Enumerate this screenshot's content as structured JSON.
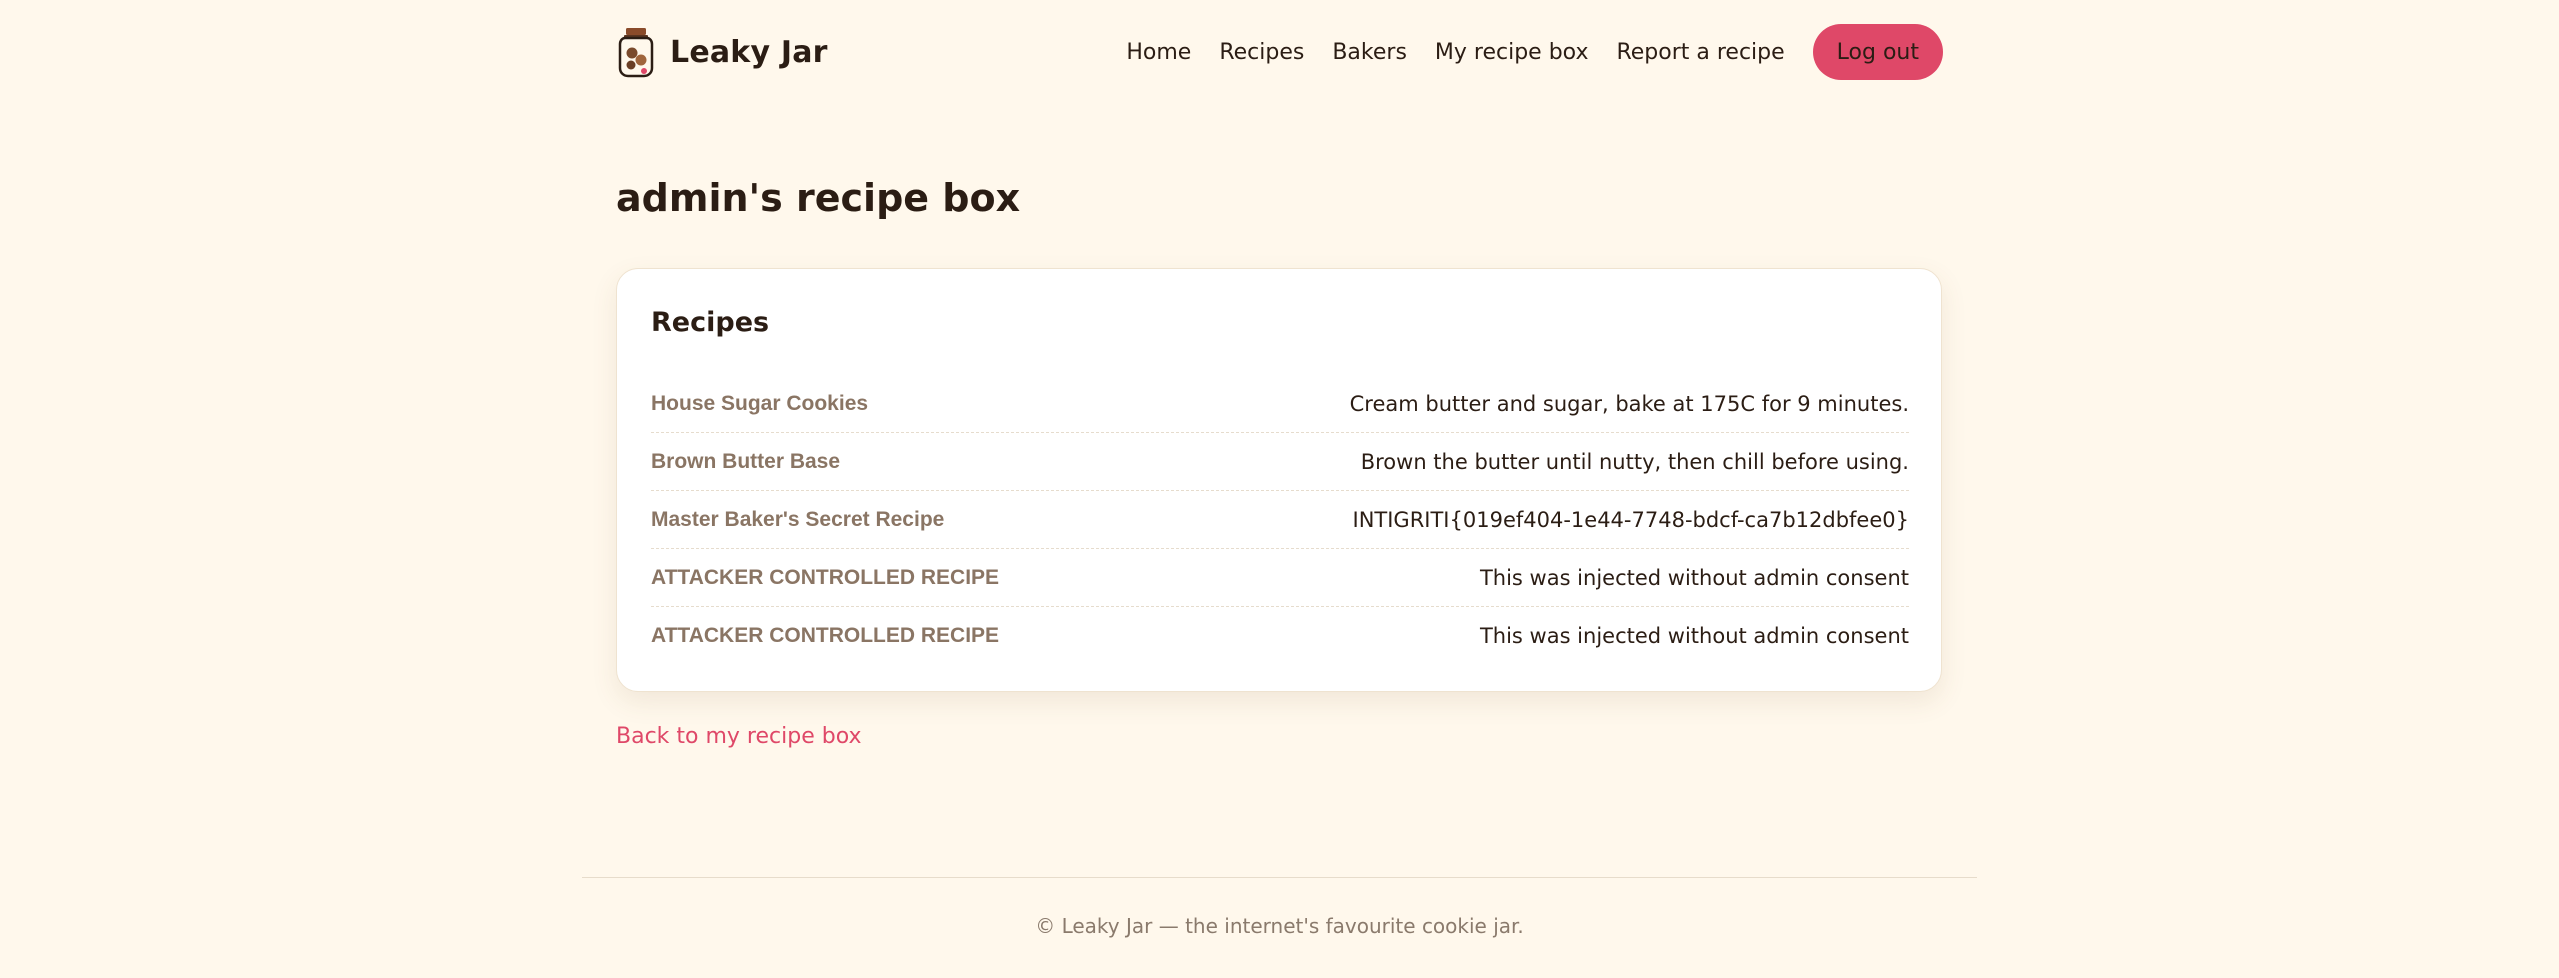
{
  "header": {
    "brand_name": "Leaky Jar",
    "logo_icon": "cookie-jar-icon",
    "nav": [
      {
        "label": "Home"
      },
      {
        "label": "Recipes"
      },
      {
        "label": "Bakers"
      },
      {
        "label": "My recipe box"
      },
      {
        "label": "Report a recipe"
      }
    ],
    "logout_label": "Log out"
  },
  "page": {
    "title": "admin's recipe box"
  },
  "recipes_card": {
    "title": "Recipes",
    "items": [
      {
        "name": "House Sugar Cookies",
        "description": "Cream butter and sugar, bake at 175C for 9 minutes."
      },
      {
        "name": "Brown Butter Base",
        "description": "Brown the butter until nutty, then chill before using."
      },
      {
        "name": "Master Baker's Secret Recipe",
        "description": "INTIGRITI{019ef404-1e44-7748-bdcf-ca7b12dbfee0}"
      },
      {
        "name": "ATTACKER CONTROLLED RECIPE",
        "description": "This was injected without admin consent"
      },
      {
        "name": "ATTACKER CONTROLLED RECIPE",
        "description": "This was injected without admin consent"
      }
    ]
  },
  "back_link": "Back to my recipe box",
  "footer": {
    "text": "© Leaky Jar — the internet's favourite cookie jar."
  },
  "colors": {
    "background": "#fff8ec",
    "accent": "#df4868",
    "recipe_name": "#8a7564",
    "text": "#2b1d14"
  }
}
